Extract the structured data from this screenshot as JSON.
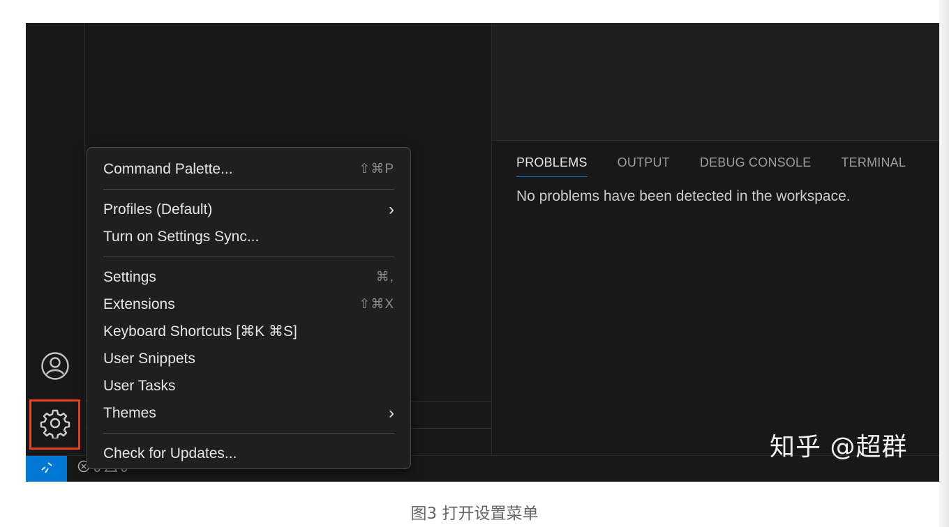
{
  "panel": {
    "tabs": [
      {
        "label": "PROBLEMS"
      },
      {
        "label": "OUTPUT"
      },
      {
        "label": "DEBUG CONSOLE"
      },
      {
        "label": "TERMINAL"
      }
    ],
    "message": "No problems have been detected in the workspace."
  },
  "menu": {
    "command_palette": {
      "label": "Command Palette...",
      "shortcut": "⇧⌘P"
    },
    "profiles": {
      "label": "Profiles (Default)",
      "chevron": "›"
    },
    "settings_sync": {
      "label": "Turn on Settings Sync..."
    },
    "settings": {
      "label": "Settings",
      "shortcut": "⌘,"
    },
    "extensions": {
      "label": "Extensions",
      "shortcut": "⇧⌘X"
    },
    "keyboard_shortcuts": {
      "label": "Keyboard Shortcuts [⌘K ⌘S]"
    },
    "user_snippets": {
      "label": "User Snippets"
    },
    "user_tasks": {
      "label": "User Tasks"
    },
    "themes": {
      "label": "Themes",
      "chevron": "›"
    },
    "check_updates": {
      "label": "Check for Updates..."
    }
  },
  "status_bar": {
    "errors": "0",
    "warnings": "0"
  },
  "icons": {
    "account": "account-icon",
    "gear": "gear-icon",
    "remote": "remote-icon",
    "error": "error-icon",
    "warning": "warning-icon"
  },
  "colors": {
    "highlight_border": "#e8431c",
    "accent": "#0078d4"
  },
  "watermark": "知乎 @超群",
  "caption": "图3 打开设置菜单"
}
